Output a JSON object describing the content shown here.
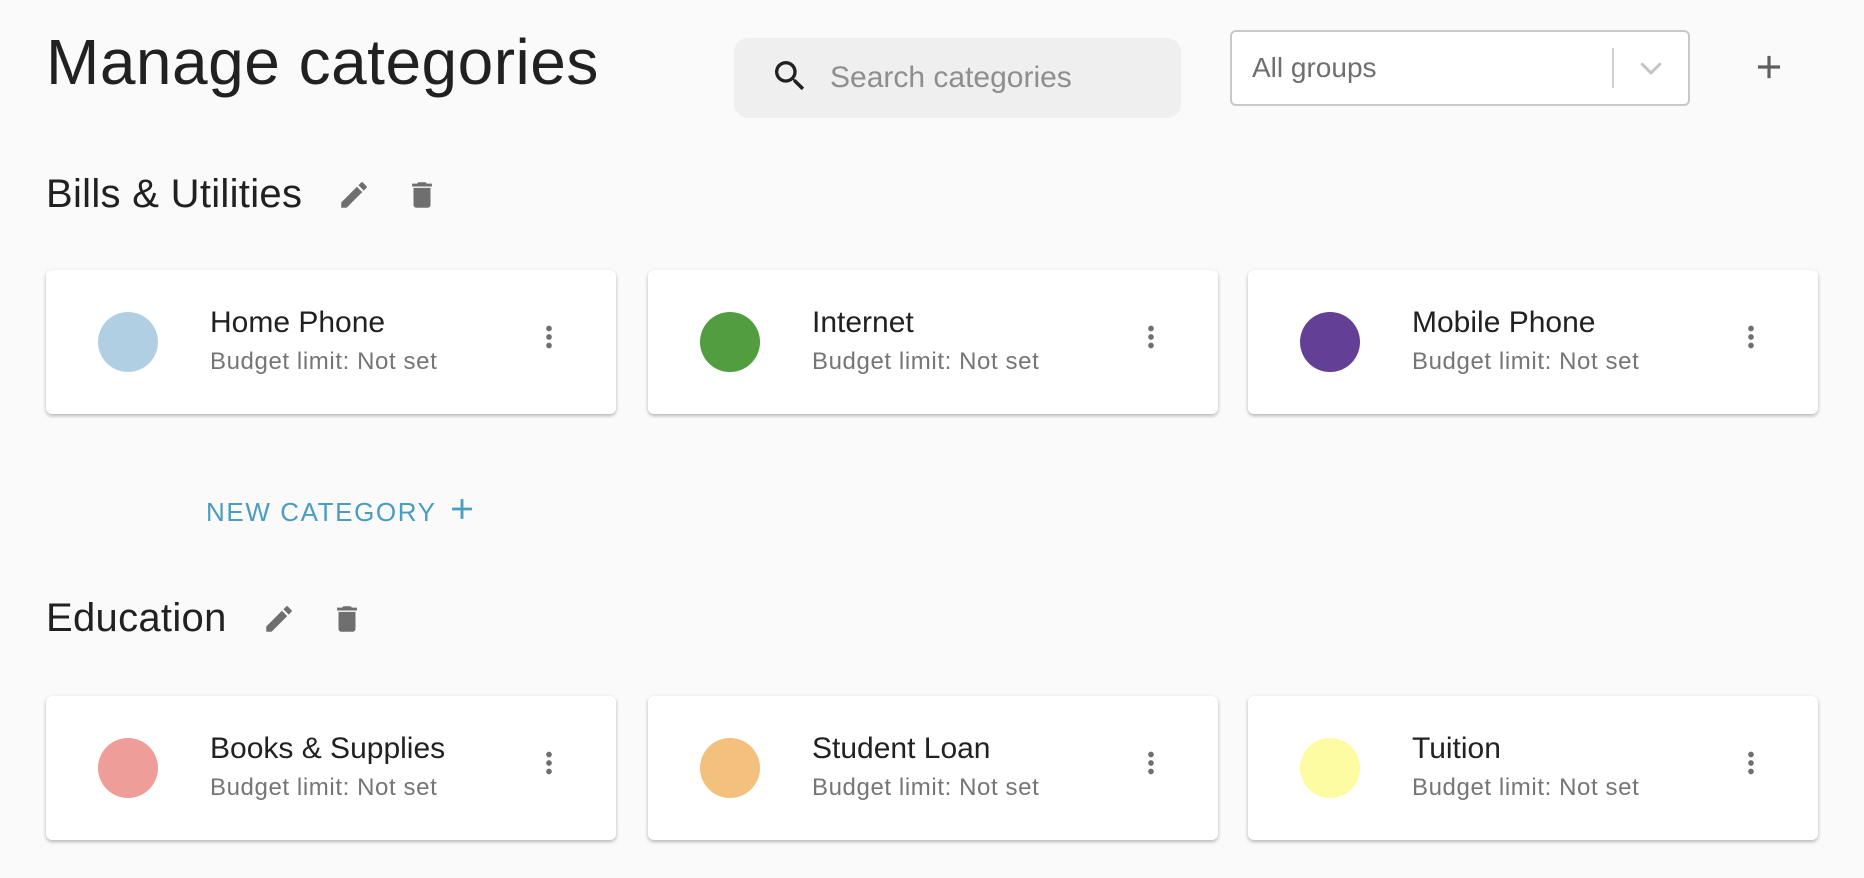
{
  "header": {
    "title": "Manage categories",
    "search_placeholder": "Search categories",
    "group_filter_value": "All groups",
    "add_icon": "plus-icon",
    "search_icon": "search-icon"
  },
  "groups": [
    {
      "name": "Bills & Utilities",
      "edit_icon": "pencil-icon",
      "delete_icon": "trash-icon",
      "categories": [
        {
          "name": "Home Phone",
          "budget": "Budget limit: Not set",
          "color": "#b0cfe3"
        },
        {
          "name": "Internet",
          "budget": "Budget limit: Not set",
          "color": "#529d3f"
        },
        {
          "name": "Mobile Phone",
          "budget": "Budget limit: Not set",
          "color": "#643f96"
        }
      ],
      "new_category_label": "NEW CATEGORY"
    },
    {
      "name": "Education",
      "edit_icon": "pencil-icon",
      "delete_icon": "trash-icon",
      "categories": [
        {
          "name": "Books & Supplies",
          "budget": "Budget limit: Not set",
          "color": "#ef9d98"
        },
        {
          "name": "Student Loan",
          "budget": "Budget limit: Not set",
          "color": "#f4c07e"
        },
        {
          "name": "Tuition",
          "budget": "Budget limit: Not set",
          "color": "#fdfca3"
        }
      ]
    }
  ],
  "colors": {
    "accent": "#4a9cc0",
    "icon_gray": "#6f6f6f"
  }
}
